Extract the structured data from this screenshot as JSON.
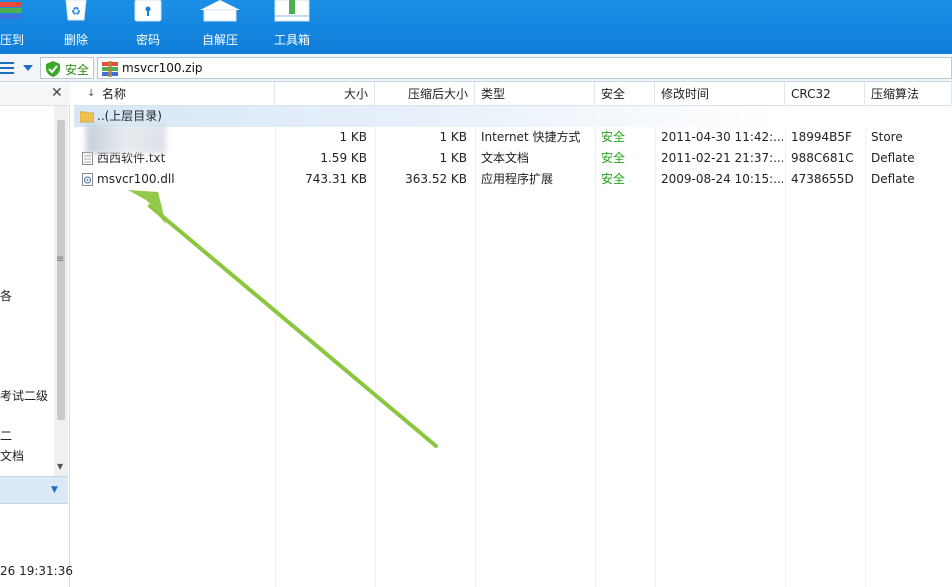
{
  "toolbar": {
    "buttons": [
      {
        "label": "压到",
        "icon": "books-icon"
      },
      {
        "label": "删除",
        "icon": "recycle-bin-icon"
      },
      {
        "label": "密码",
        "icon": "lock-icon"
      },
      {
        "label": "自解压",
        "icon": "house-icon"
      },
      {
        "label": "工具箱",
        "icon": "toolbox-icon"
      }
    ]
  },
  "address": {
    "safe_label": "安全",
    "path": "msvcr100.zip"
  },
  "tree": {
    "items": [
      "各",
      "考试二级",
      "二",
      "文档"
    ],
    "time": "26 19:31:36"
  },
  "columns": [
    "名称",
    "大小",
    "压缩后大小",
    "类型",
    "安全",
    "修改时间",
    "CRC32",
    "压缩算法"
  ],
  "parent_row": "..(上层目录)",
  "files": [
    {
      "name": "",
      "size": "1 KB",
      "packed": "1 KB",
      "type": "Internet 快捷方式",
      "safe": "安全",
      "modified": "2011-04-30 11:42:...",
      "crc": "18994B5F",
      "method": "Store"
    },
    {
      "name": "西西软件.txt",
      "size": "1.59 KB",
      "packed": "1 KB",
      "type": "文本文档",
      "safe": "安全",
      "modified": "2011-02-21 21:37:...",
      "crc": "988C681C",
      "method": "Deflate"
    },
    {
      "name": "msvcr100.dll",
      "size": "743.31 KB",
      "packed": "363.52 KB",
      "type": "应用程序扩展",
      "safe": "安全",
      "modified": "2009-08-24 10:15:...",
      "crc": "4738655D",
      "method": "Deflate"
    }
  ],
  "colors": {
    "toolbar": "#1287e0",
    "safe_green": "#22a31a",
    "arrow": "#8cc63f"
  }
}
